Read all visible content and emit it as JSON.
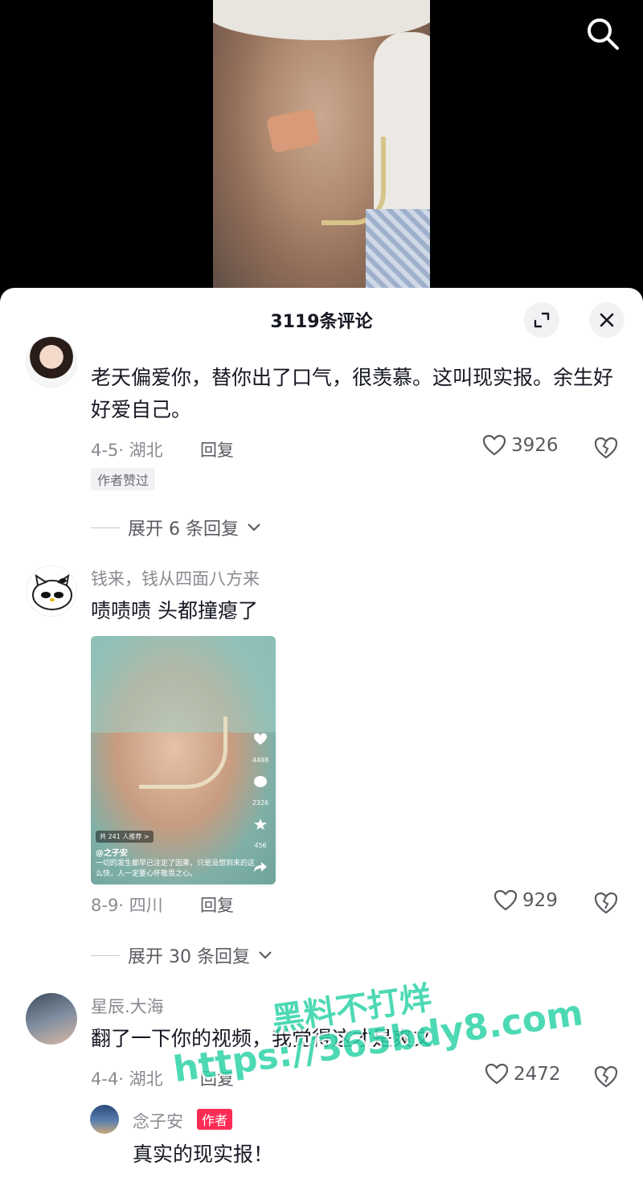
{
  "panel": {
    "title": "3119条评论"
  },
  "comments": [
    {
      "name": "",
      "text": "老天偏爱你，替你出了口气，很羡慕。这叫现实报。余生好好爱自己。",
      "meta": "4-5· 湖北",
      "reply_label": "回复",
      "likes": "3926",
      "badge": "作者赞过",
      "expand": "展开 6 条回复"
    },
    {
      "name": "钱来，钱从四面八方来",
      "text": "啧啧啧 头都撞瘪了",
      "meta": "8-9· 四川",
      "reply_label": "回复",
      "likes": "929",
      "expand": "展开 30 条回复",
      "thumbnail": {
        "recommend": "共 241 人推荐 >",
        "handle": "@之子安",
        "caption": "一切的发生都早已注定了因果，只是没想到来的这么快，人一定要心怀敬畏之心。",
        "likes": "4498",
        "comments": "2326",
        "favorites": "456"
      }
    },
    {
      "name": "星辰.大海",
      "text": "翻了一下你的视频，我觉得这才是爽文",
      "meta": "4-4· 湖北",
      "reply_label": "回复",
      "likes": "2472"
    }
  ],
  "author_reply": {
    "name": "念子安",
    "tag": "作者",
    "text": "真实的现实报！"
  },
  "watermark": {
    "line1": "黑料不打烊",
    "line2": "https://365bdy8.com"
  },
  "colors": {
    "accent": "#fe2c55",
    "watermark": "#2fd3a8"
  }
}
